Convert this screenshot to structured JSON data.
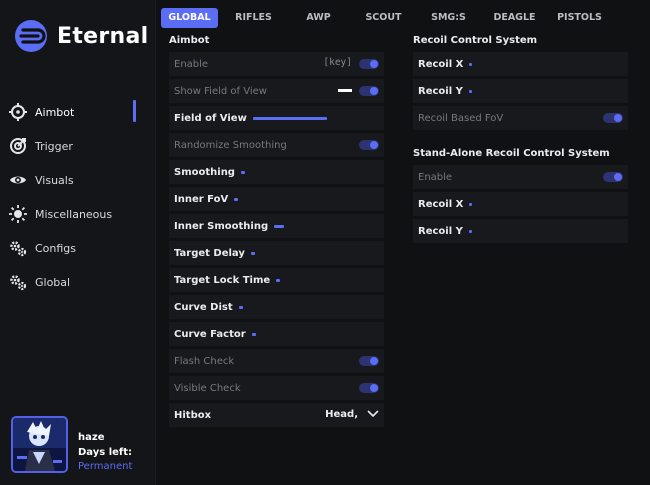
{
  "app": {
    "name": "Eternal"
  },
  "sidebar": {
    "items": [
      {
        "label": "Aimbot",
        "icon": "crosshair-icon",
        "active": true
      },
      {
        "label": "Trigger",
        "icon": "target-icon",
        "active": false
      },
      {
        "label": "Visuals",
        "icon": "eye-icon",
        "active": false
      },
      {
        "label": "Miscellaneous",
        "icon": "sun-icon",
        "active": false
      },
      {
        "label": "Configs",
        "icon": "gears-icon",
        "active": false
      },
      {
        "label": "Global",
        "icon": "gears-icon",
        "active": false
      }
    ],
    "profile": {
      "username": "haze",
      "days_label": "Days left:",
      "plan": "Permanent"
    }
  },
  "tabs": [
    "GLOBAL",
    "RIFLES",
    "AWP",
    "SCOUT",
    "SMG:S",
    "DEAGLE",
    "PISTOLS"
  ],
  "aimbot": {
    "title": "Aimbot",
    "rows": [
      {
        "label": "Enable",
        "type": "toggle",
        "enabled": false,
        "keybind": "[key]"
      },
      {
        "label": "Show Field of View",
        "type": "toggle",
        "enabled": false,
        "color": "#ffffff"
      },
      {
        "label": "Field of View",
        "type": "slider",
        "enabled": true,
        "fill": 0.53
      },
      {
        "label": "Randomize Smoothing",
        "type": "toggle",
        "enabled": false
      },
      {
        "label": "Smoothing",
        "type": "slider",
        "enabled": true,
        "fill": 0.03
      },
      {
        "label": "Inner FoV",
        "type": "slider",
        "enabled": true,
        "fill": 0.03
      },
      {
        "label": "Inner Smoothing",
        "type": "slider",
        "enabled": true,
        "fill": 0.07
      },
      {
        "label": "Target Delay",
        "type": "slider",
        "enabled": true,
        "fill": 0.03
      },
      {
        "label": "Target Lock Time",
        "type": "slider",
        "enabled": true,
        "fill": 0.03
      },
      {
        "label": "Curve Dist",
        "type": "slider",
        "enabled": true,
        "fill": 0.03
      },
      {
        "label": "Curve Factor",
        "type": "slider",
        "enabled": true,
        "fill": 0.03
      },
      {
        "label": "Flash Check",
        "type": "toggle",
        "enabled": false
      },
      {
        "label": "Visible Check",
        "type": "toggle",
        "enabled": false
      },
      {
        "label": "Hitbox",
        "type": "select",
        "enabled": true,
        "value": "Head,"
      }
    ]
  },
  "rcs": {
    "title": "Recoil Control System",
    "rows": [
      {
        "label": "Recoil X",
        "type": "slider",
        "enabled": true,
        "fill": 0.02
      },
      {
        "label": "Recoil Y",
        "type": "slider",
        "enabled": true,
        "fill": 0.02
      },
      {
        "label": "Recoil Based FoV",
        "type": "toggle",
        "enabled": false
      }
    ]
  },
  "standalone_rcs": {
    "title": "Stand-Alone Recoil Control System",
    "rows": [
      {
        "label": "Enable",
        "type": "toggle",
        "enabled": false
      },
      {
        "label": "Recoil X",
        "type": "slider",
        "enabled": true,
        "fill": 0.02
      },
      {
        "label": "Recoil Y",
        "type": "slider",
        "enabled": true,
        "fill": 0.02
      }
    ]
  },
  "colors": {
    "accent": "#5b6cf5",
    "panel": "#18191c",
    "background": "#101113"
  }
}
